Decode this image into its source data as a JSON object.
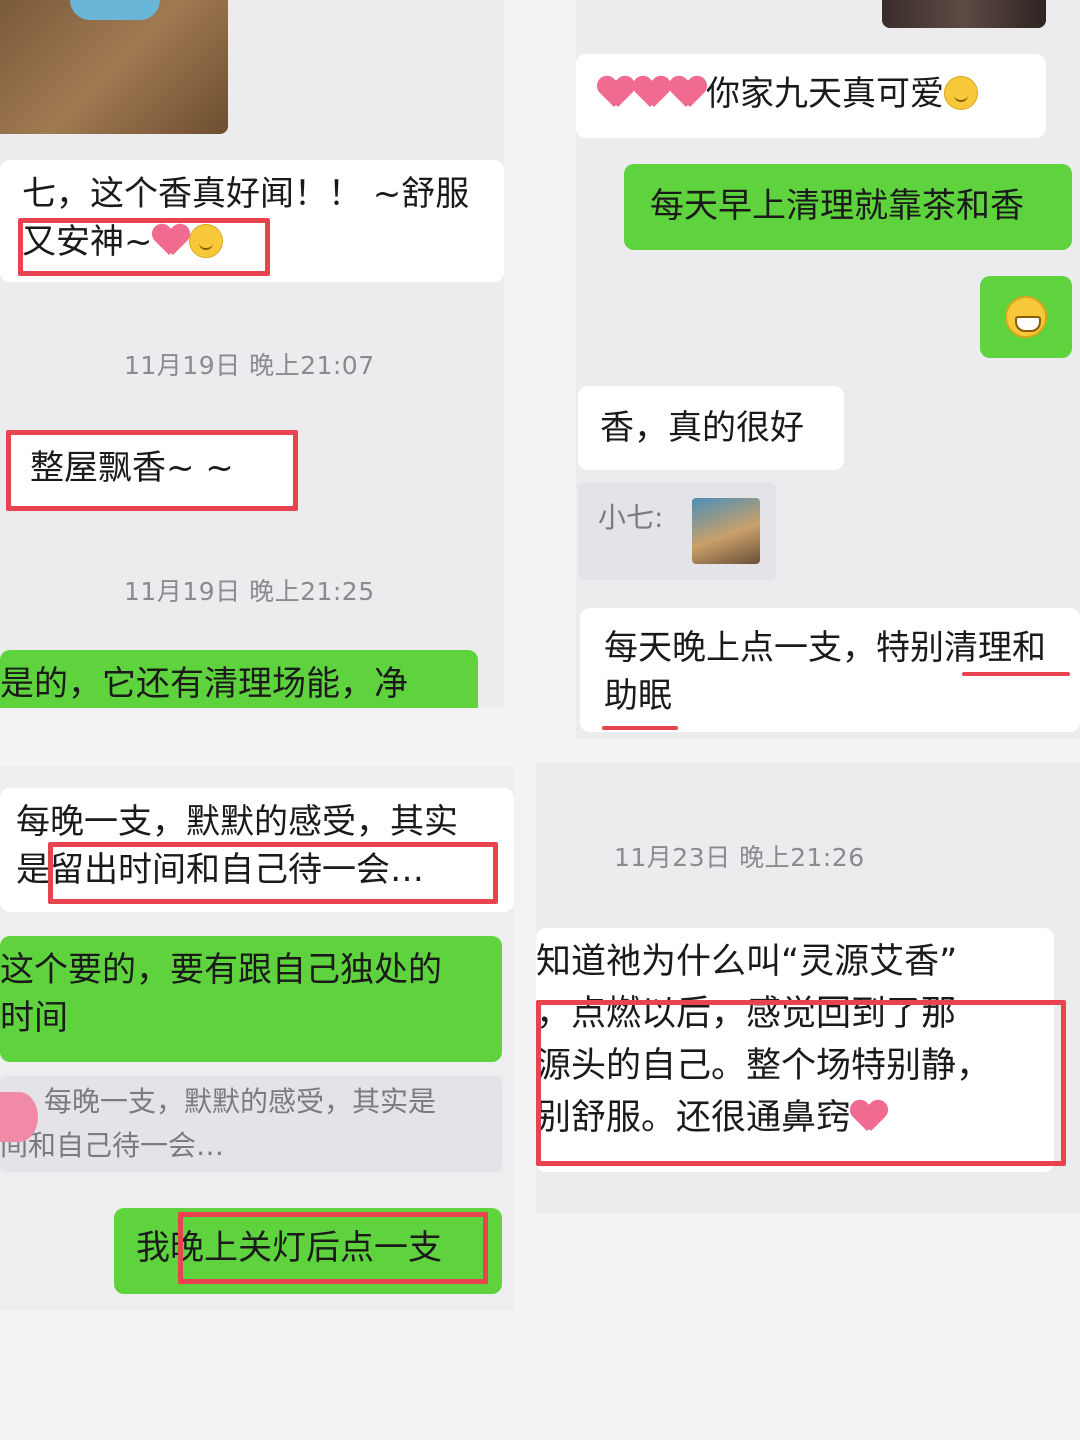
{
  "left_top": {
    "msg1": "七，这个香真好闻！！ ~舒服",
    "msg1b": "又安神~",
    "ts1": "11月19日 晚上21:07",
    "msg2": "整屋飘香~ ~ ~",
    "ts2": "11月19日 晚上21:25",
    "msg3": "是的，它还有清理场能，净化，"
  },
  "left_bottom": {
    "msg1a": "每晚一支，默默的感受，其实",
    "msg1b": "是留出时间和自己待一会…",
    "reply1a": "这个要的，要有跟自己独处的",
    "reply1b": "时间",
    "quote_a": "每晚一支，默默的感受，其实是",
    "quote_b": "间和自己待一会…",
    "reply2": "我晚上关灯后点一支"
  },
  "right_top": {
    "msg1": "你家九天真可爱",
    "reply1": "每天早上清理就靠茶和香",
    "msg2": "香，真的很好",
    "quote_label": "小七:",
    "msg3a": "每天晚上点一支，特别清理和",
    "msg3b": "助眠"
  },
  "right_bottom": {
    "ts": "11月23日 晚上21:26",
    "l1": "知道祂为什么叫“灵源艾香”",
    "l2": "，点燃以后，感觉回到了那",
    "l3": "源头的自己。整个场特别静，",
    "l4": "别舒服。还很通鼻窍"
  },
  "colors": {
    "green_bubble": "#5fd33e",
    "highlight_red": "#e9434f"
  }
}
